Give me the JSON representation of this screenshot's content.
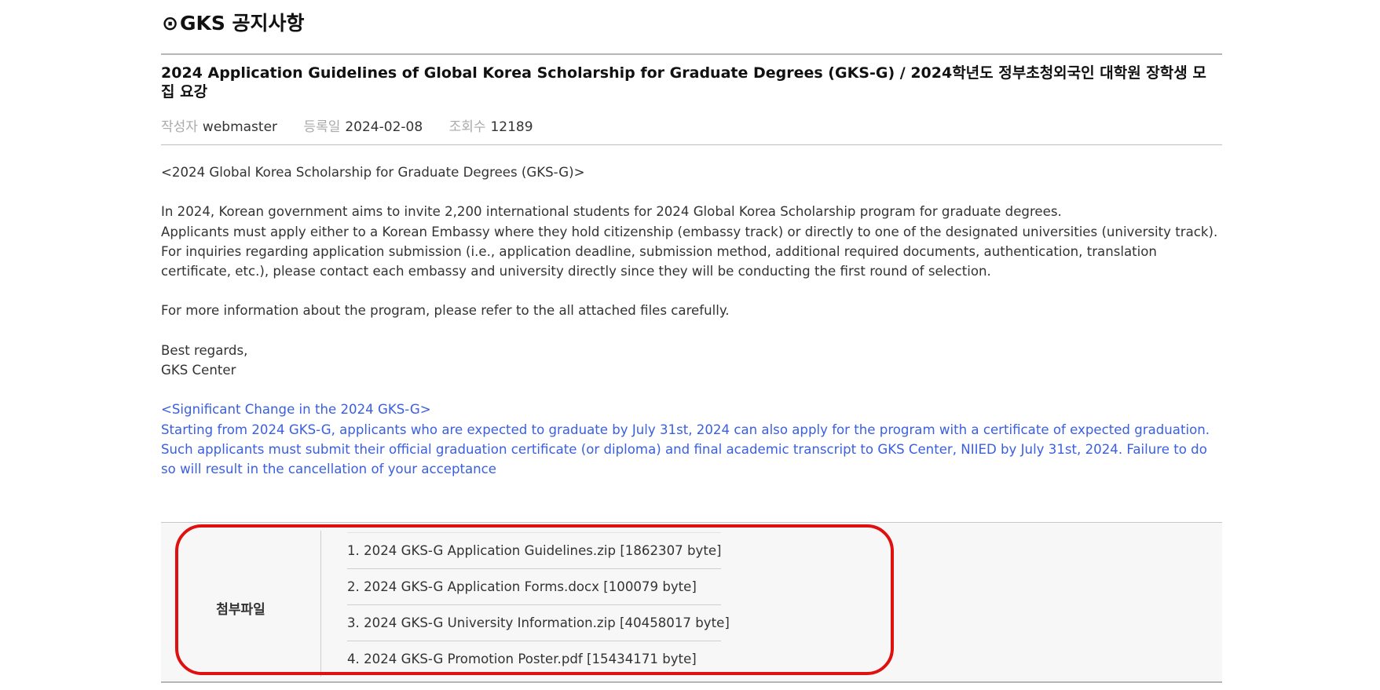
{
  "board": {
    "mark": "⊙",
    "title": "GKS 공지사항"
  },
  "post": {
    "title": "2024 Application Guidelines of Global Korea Scholarship for Graduate Degrees (GKS-G) / 2024학년도 정부초청외국인 대학원 장학생 모집 요강",
    "meta": {
      "author_label": "작성자",
      "author": "webmaster",
      "date_label": "등록일",
      "date": "2024-02-08",
      "views_label": "조회수",
      "views": "12189"
    },
    "body": {
      "heading": "<2024  Global Korea Scholarship for Graduate Degrees (GKS-G)>",
      "para1_line1": "In 2024, Korean government aims to invite 2,200 international students for 2024 Global Korea Scholarship program for graduate degrees.",
      "para1_line2": "Applicants must apply either to a Korean Embassy where they hold citizenship (embassy track) or directly to one of the designated universities (university track).",
      "para1_line3": "For inquiries regarding application submission (i.e., application deadline, submission method, additional required documents, authentication, translation certificate, etc.), please contact each embassy and university directly since they will be conducting the first round of selection.",
      "para2": "For more information about the program, please refer to the all attached files carefully.",
      "closing1": "Best regards,",
      "closing2": "GKS Center",
      "notice_heading": "<Significant Change in the 2024 GKS-G>",
      "notice_text": "Starting from 2024 GKS-G, applicants who are expected to graduate by July 31st, 2024 can also apply for the program with a certificate of expected graduation. Such applicants must submit their official graduation certificate (or diploma) and final academic transcript to GKS Center, NIIED by July 31st, 2024. Failure to do so will result in the cancellation of your acceptance"
    }
  },
  "attachments": {
    "label": "첨부파일",
    "files": [
      "1. 2024 GKS-G Application Guidelines.zip [1862307 byte]",
      "2. 2024 GKS-G Application Forms.docx [100079 byte]",
      "3. 2024 GKS-G University Information.zip [40458017 byte]",
      "4. 2024 GKS-G Promotion Poster.pdf [15434171 byte]"
    ]
  },
  "colors": {
    "notice_blue": "#3a5fe0",
    "highlight_red": "#e01010"
  }
}
